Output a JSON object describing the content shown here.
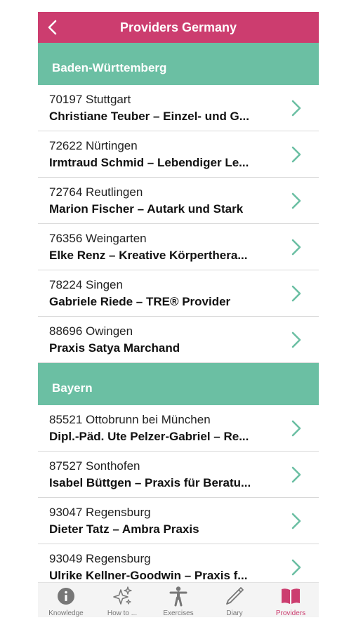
{
  "header": {
    "title": "Providers Germany",
    "back_icon": "chevron-left-icon"
  },
  "colors": {
    "brand": "#cc3d6f",
    "section": "#6bbfa3",
    "chevron": "#6bbfa3"
  },
  "sections": [
    {
      "title": "Baden-Württemberg",
      "items": [
        {
          "location": "70197 Stuttgart",
          "name": "Christiane Teuber – Einzel- und G..."
        },
        {
          "location": "72622 Nürtingen",
          "name": "Irmtraud Schmid – Lebendiger Le..."
        },
        {
          "location": "72764 Reutlingen",
          "name": "Marion Fischer – Autark und Stark"
        },
        {
          "location": "76356 Weingarten",
          "name": "Elke Renz – Kreative Körperthera..."
        },
        {
          "location": "78224 Singen",
          "name": "Gabriele Riede – TRE® Provider"
        },
        {
          "location": "88696 Owingen",
          "name": "Praxis Satya Marchand"
        }
      ]
    },
    {
      "title": "Bayern",
      "items": [
        {
          "location": "85521 Ottobrunn bei München",
          "name": "Dipl.-Päd. Ute Pelzer-Gabriel – Re..."
        },
        {
          "location": "87527 Sonthofen",
          "name": "Isabel Büttgen – Praxis für Beratu..."
        },
        {
          "location": "93047 Regensburg",
          "name": "Dieter Tatz – Ambra Praxis"
        },
        {
          "location": "93049 Regensburg",
          "name": "Ulrike Kellner-Goodwin – Praxis f..."
        }
      ]
    }
  ],
  "tabs": [
    {
      "label": "Knowledge",
      "icon": "info-icon"
    },
    {
      "label": "How to ...",
      "icon": "sparkles-icon"
    },
    {
      "label": "Exercises",
      "icon": "person-icon"
    },
    {
      "label": "Diary",
      "icon": "pencil-icon"
    },
    {
      "label": "Providers",
      "icon": "book-icon",
      "active": true
    }
  ]
}
